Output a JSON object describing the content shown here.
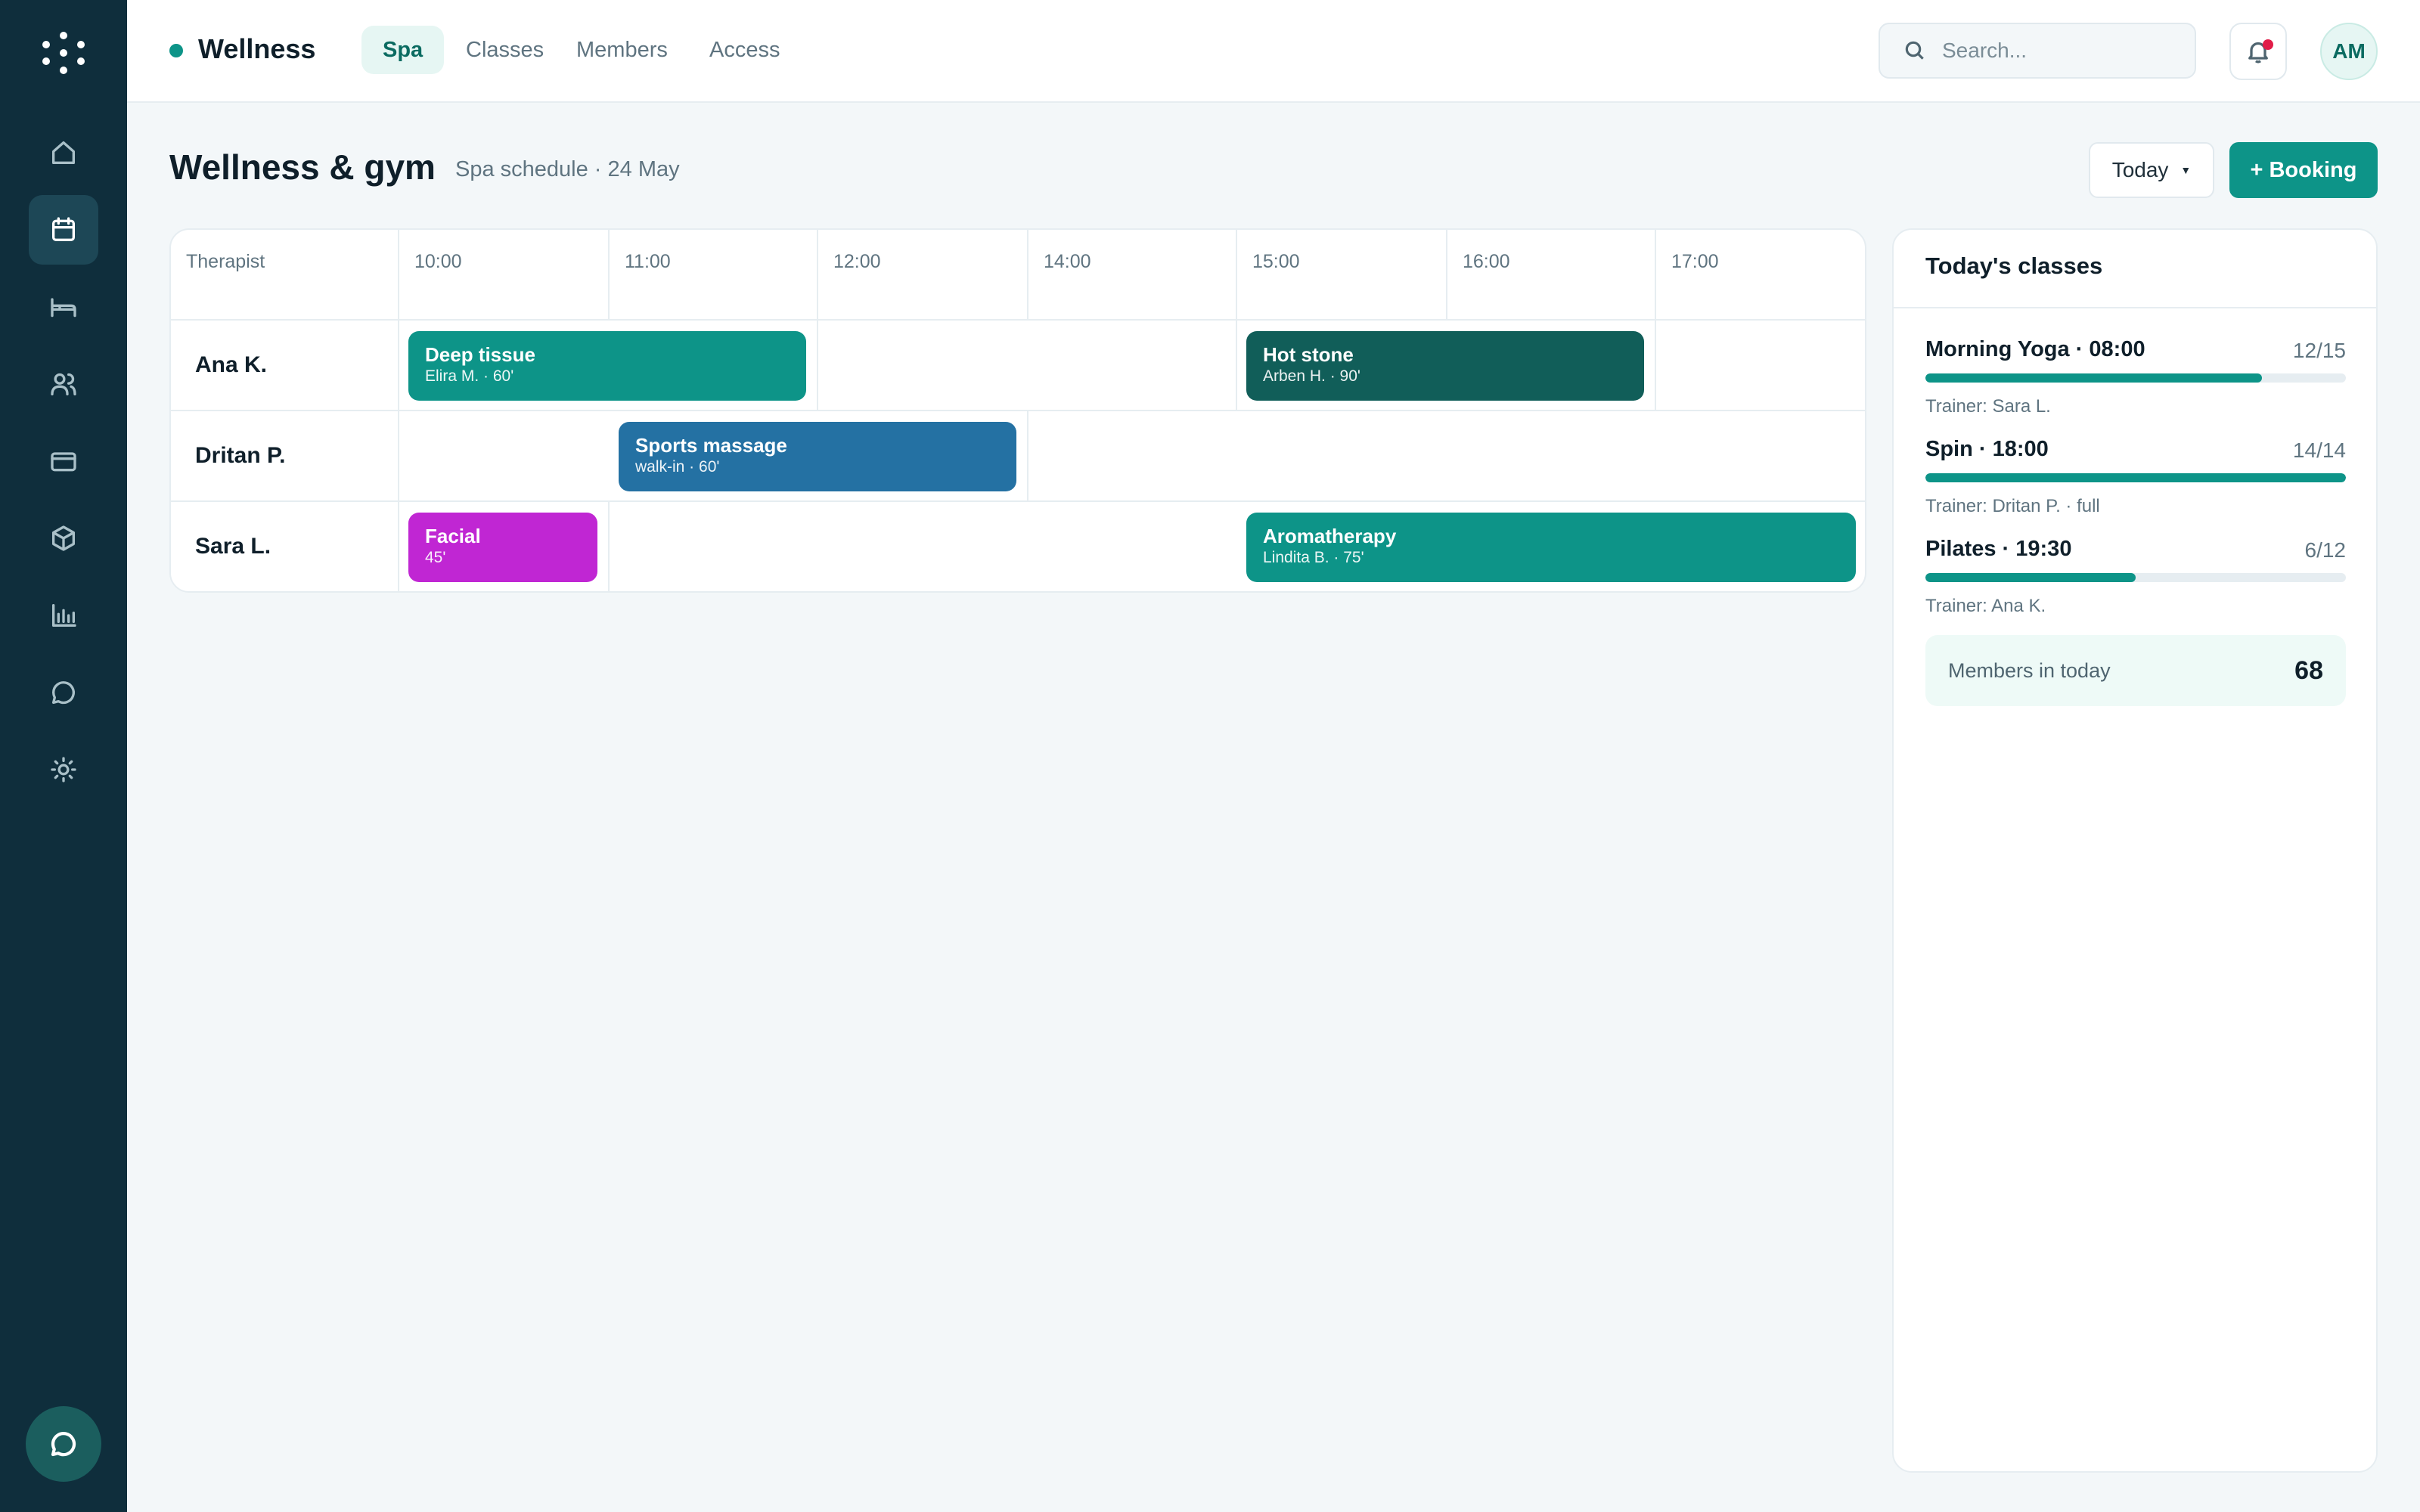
{
  "app": {
    "brand": "Wellness",
    "colors": {
      "accent": "#0d9488",
      "sidebar": "#0f2e3c"
    }
  },
  "nav": {
    "tabs": [
      {
        "label": "Spa",
        "active": true
      },
      {
        "label": "Classes",
        "active": false
      },
      {
        "label": "Members",
        "active": false
      },
      {
        "label": "Access",
        "active": false
      }
    ]
  },
  "search": {
    "placeholder": "Search..."
  },
  "user": {
    "initials": "AM"
  },
  "sidebar": {
    "items": [
      {
        "icon": "home-icon"
      },
      {
        "icon": "calendar-icon",
        "active": true
      },
      {
        "icon": "bed-icon"
      },
      {
        "icon": "users-icon"
      },
      {
        "icon": "card-icon"
      },
      {
        "icon": "box-icon"
      },
      {
        "icon": "bar-chart-icon"
      },
      {
        "icon": "chat-icon"
      },
      {
        "icon": "sun-icon"
      }
    ]
  },
  "page": {
    "title": "Wellness & gym",
    "subtitle": "Spa schedule · 24 May",
    "today_label": "Today",
    "booking_label": "+ Booking"
  },
  "schedule": {
    "first_header": "Therapist",
    "times": [
      "10:00",
      "11:00",
      "12:00",
      "14:00",
      "15:00",
      "16:00",
      "17:00"
    ],
    "therapists": [
      "Ana K.",
      "Dritan P.",
      "Sara L."
    ],
    "bookings": [
      {
        "title": "Deep tissue",
        "sub": "Elira M. · 60'",
        "color": "#0d9488"
      },
      {
        "title": "Hot stone",
        "sub": "Arben H. · 90'",
        "color": "#115e59"
      },
      {
        "title": "Sports massage",
        "sub": "walk-in · 60'",
        "color": "#2471a3"
      },
      {
        "title": "Facial",
        "sub": "45'",
        "color": "#c026d3"
      },
      {
        "title": "Aromatherapy",
        "sub": "Lindita B. · 75'",
        "color": "#0d9488"
      }
    ]
  },
  "classes": {
    "title": "Today's classes",
    "items": [
      {
        "name": "Morning Yoga · 08:00",
        "count": "12/15",
        "fill": 0.8,
        "trainer": "Trainer: Sara L."
      },
      {
        "name": "Spin · 18:00",
        "count": "14/14",
        "fill": 1.0,
        "trainer": "Trainer: Dritan P. · full"
      },
      {
        "name": "Pilates · 19:30",
        "count": "6/12",
        "fill": 0.5,
        "trainer": "Trainer: Ana K."
      }
    ],
    "members_label": "Members in today",
    "members_value": "68"
  }
}
